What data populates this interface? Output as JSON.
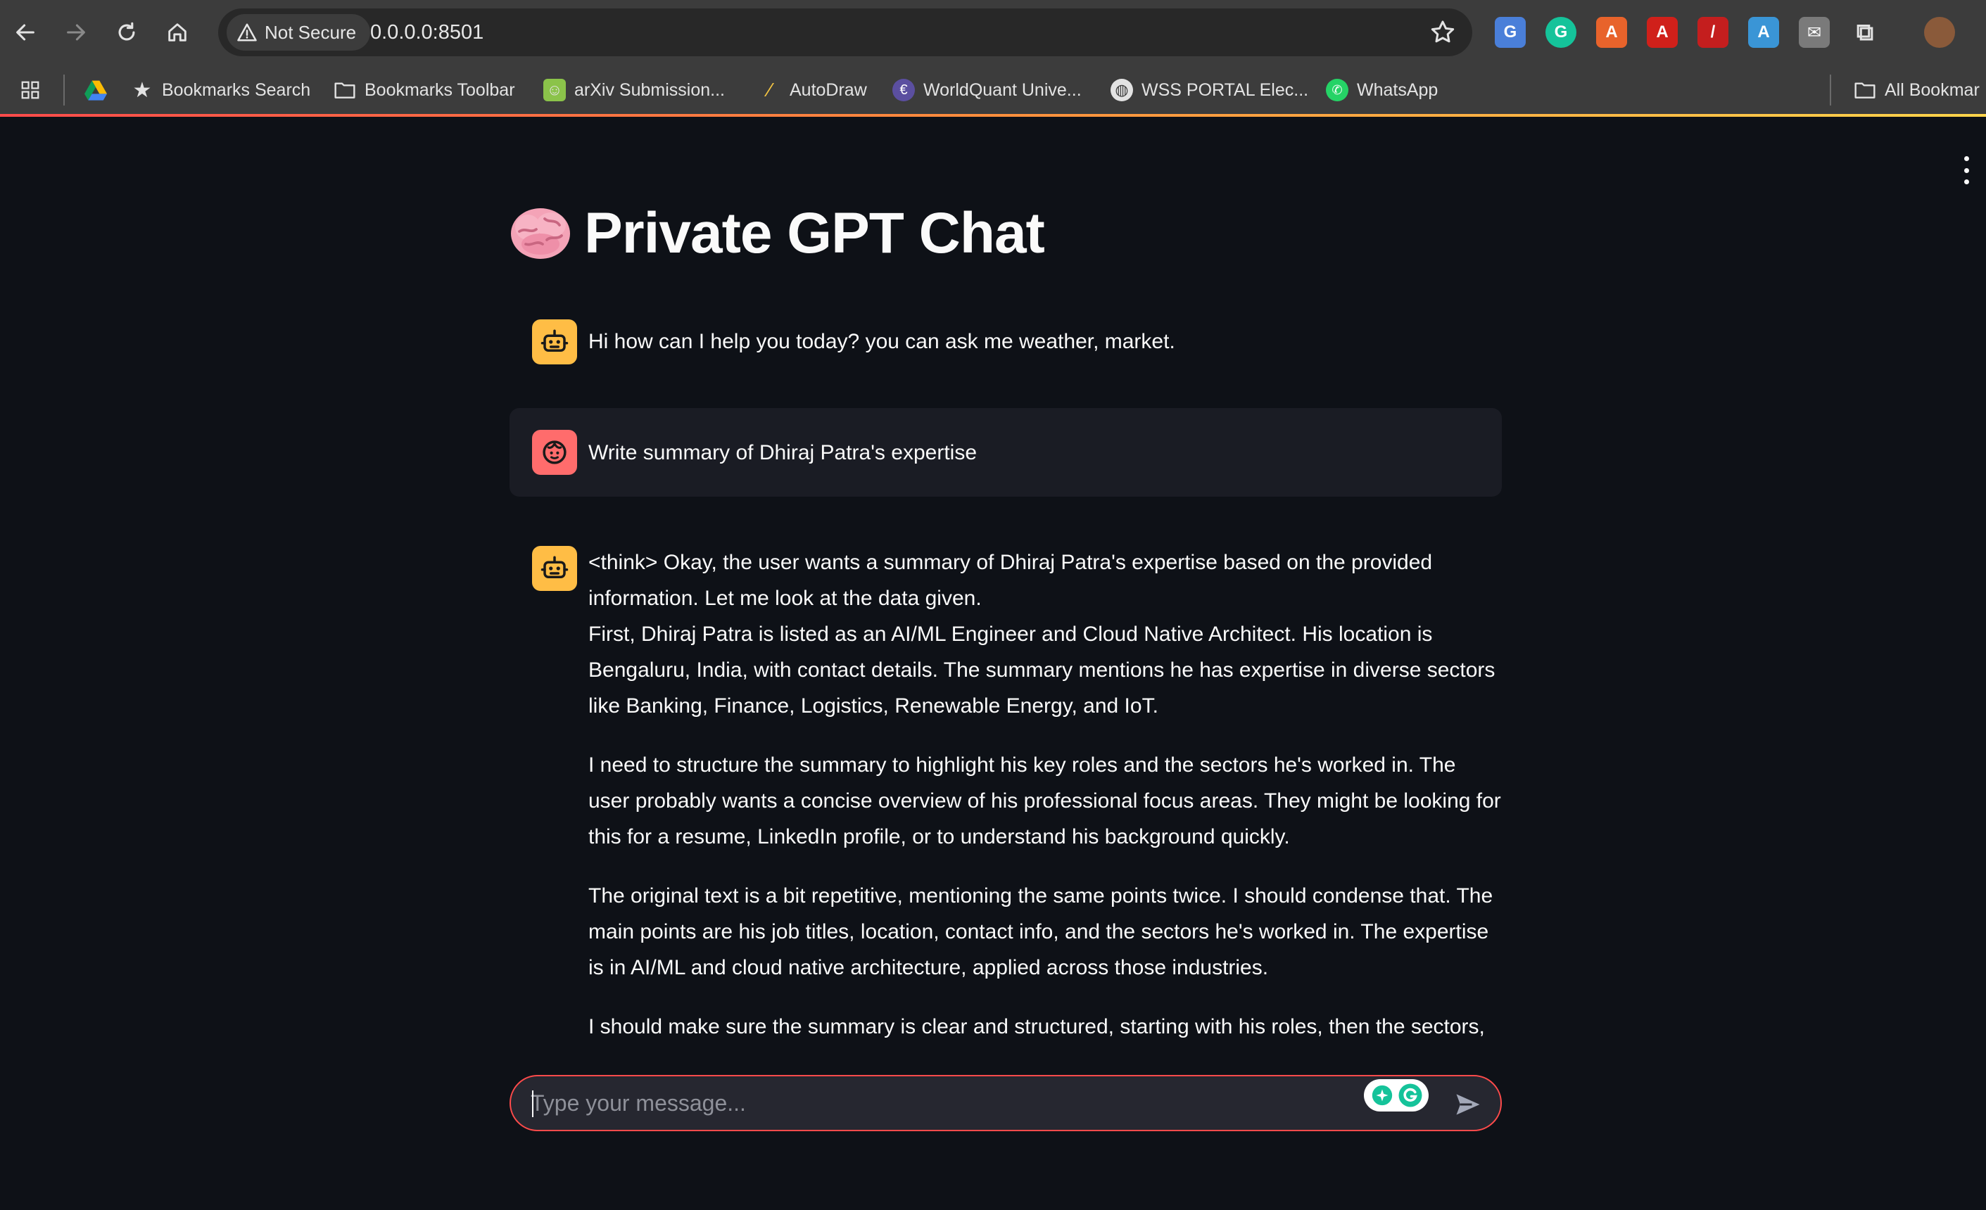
{
  "browser": {
    "security_label": "Not Secure",
    "url": "0.0.0.0:8501",
    "bookmarks": [
      {
        "label": "Bookmarks Search",
        "icon": "star-icon"
      },
      {
        "label": "Bookmarks Toolbar",
        "icon": "folder-icon"
      },
      {
        "label": "arXiv Submission...",
        "icon": "arxiv-icon"
      },
      {
        "label": "AutoDraw",
        "icon": "autodraw-icon"
      },
      {
        "label": "WorldQuant Unive...",
        "icon": "worldquant-icon"
      },
      {
        "label": "WSS PORTAL Elec...",
        "icon": "globe-icon"
      },
      {
        "label": "WhatsApp",
        "icon": "whatsapp-icon"
      }
    ],
    "all_bookmarks": "All Bookmar"
  },
  "app": {
    "title": "Private GPT Chat",
    "title_icon": "brain-icon",
    "messages": [
      {
        "role": "assistant",
        "paragraphs": [
          "Hi how can I help you today? you can ask me weather, market."
        ]
      },
      {
        "role": "user",
        "paragraphs": [
          "Write summary of Dhiraj Patra's expertise"
        ]
      },
      {
        "role": "assistant",
        "paragraphs": [
          "<think> Okay, the user wants a summary of Dhiraj Patra's expertise based on the provided information. Let me look at the data given.",
          "First, Dhiraj Patra is listed as an AI/ML Engineer and Cloud Native Architect. His location is Bengaluru, India, with contact details. The summary mentions he has expertise in diverse sectors like Banking, Finance, Logistics, Renewable Energy, and IoT.",
          "I need to structure the summary to highlight his key roles and the sectors he's worked in. The user probably wants a concise overview of his professional focus areas. They might be looking for this for a resume, LinkedIn profile, or to understand his background quickly.",
          "The original text is a bit repetitive, mentioning the same points twice. I should condense that. The main points are his job titles, location, contact info, and the sectors he's worked in. The expertise is in AI/ML and cloud native architecture, applied across those industries.",
          "I should make sure the summary is clear and structured, starting with his roles, then the sectors,"
        ]
      }
    ],
    "input_placeholder": "Type your message..."
  },
  "colors": {
    "background": "#0e1117",
    "accent": "#ff4b4b",
    "bot_avatar": "#ffbd45",
    "user_avatar": "#ff6c6c"
  }
}
